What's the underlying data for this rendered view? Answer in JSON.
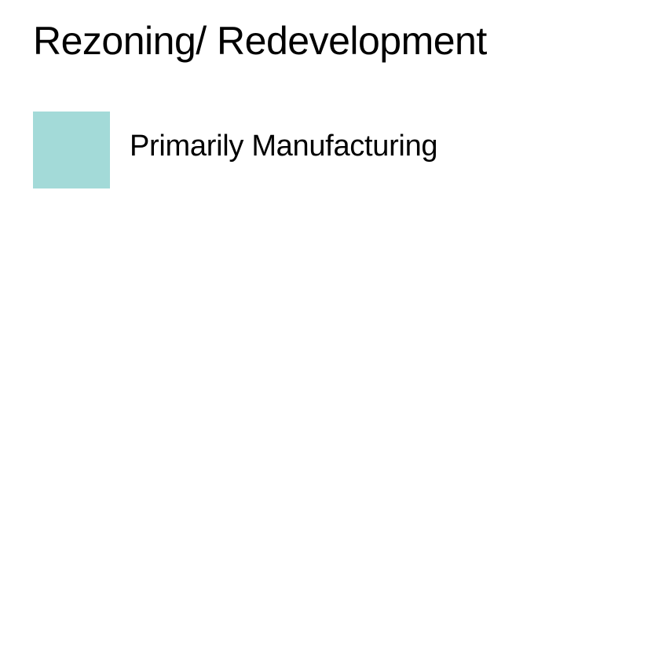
{
  "legend": {
    "title": "Rezoning/ Redevelopment",
    "items": [
      {
        "label": "Primarily Manufacturing",
        "color": "#a3dad8"
      }
    ]
  }
}
